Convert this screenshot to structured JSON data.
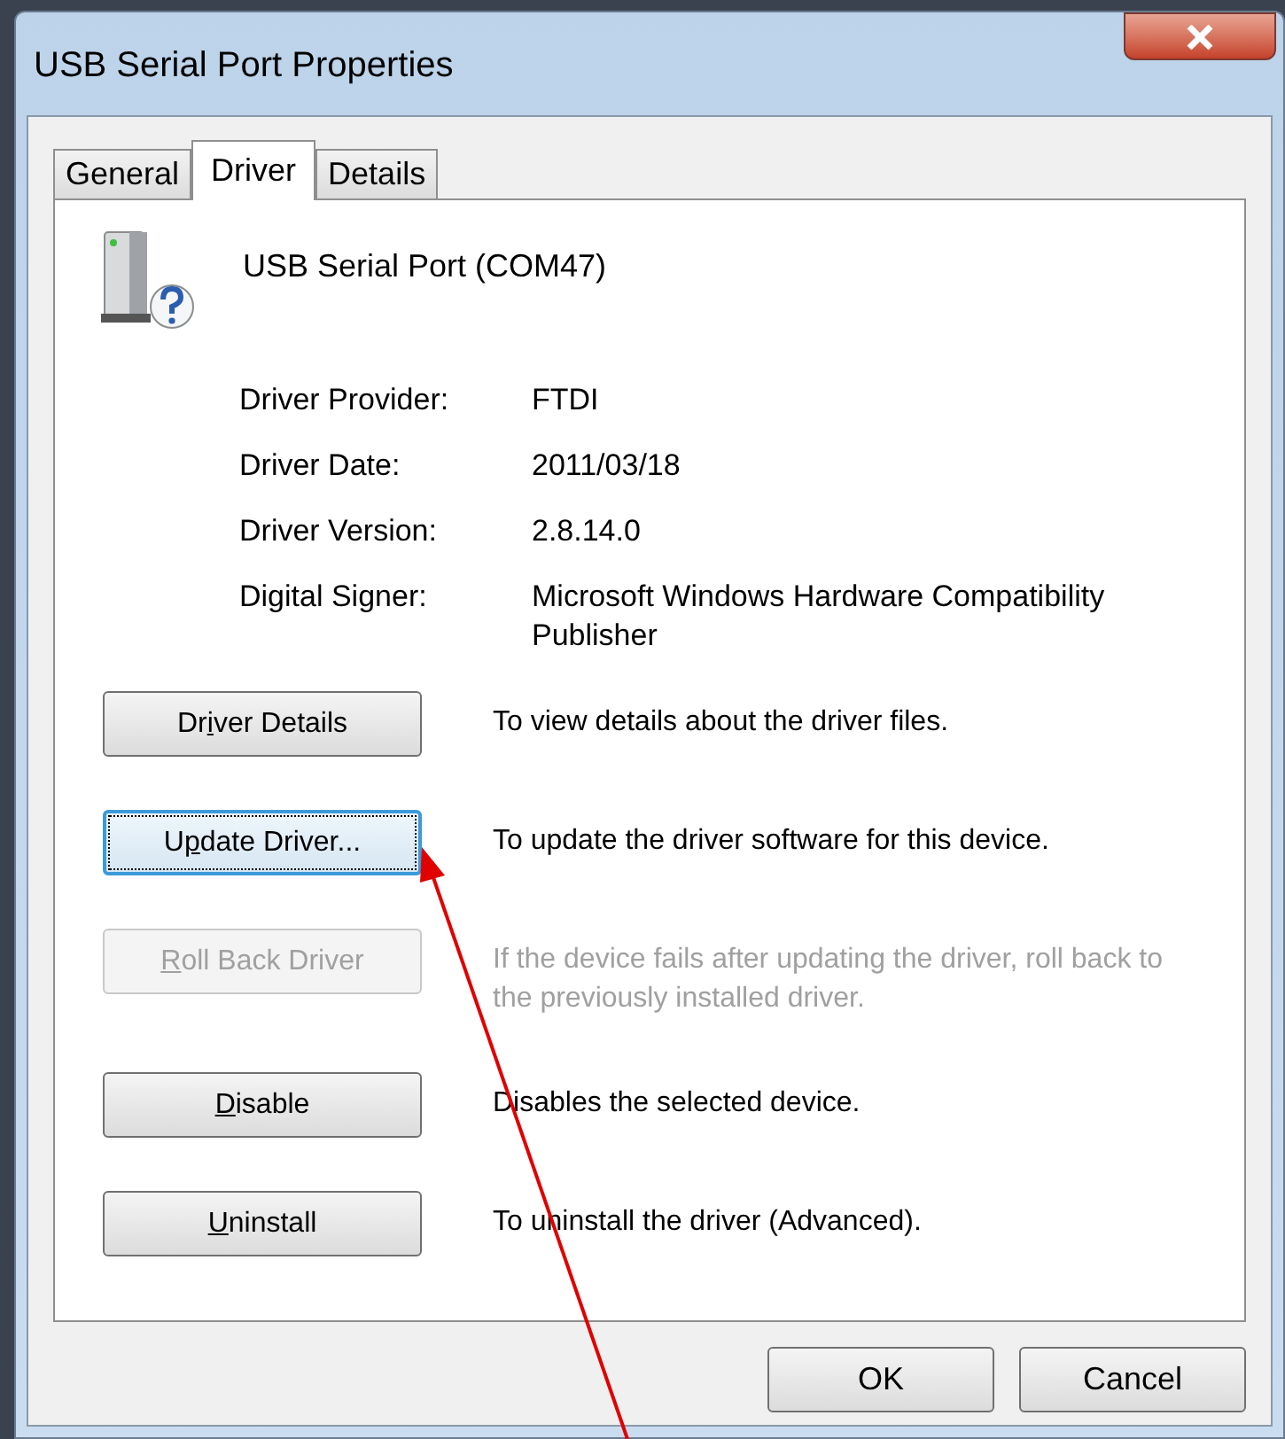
{
  "window": {
    "title": "USB Serial Port Properties"
  },
  "tabs": [
    {
      "label": "General",
      "selected": false
    },
    {
      "label": "Driver",
      "selected": true
    },
    {
      "label": "Details",
      "selected": false
    }
  ],
  "device": {
    "name": "USB Serial Port (COM47)"
  },
  "info": [
    {
      "label": "Driver Provider:",
      "value": "FTDI"
    },
    {
      "label": "Driver Date:",
      "value": "2011/03/18"
    },
    {
      "label": "Driver Version:",
      "value": "2.8.14.0"
    },
    {
      "label": "Digital Signer:",
      "value": "Microsoft Windows Hardware Compatibility Publisher"
    }
  ],
  "actions": [
    {
      "label": {
        "before": "Dr",
        "key": "i",
        "after": "ver Details"
      },
      "description": "To view details about the driver files.",
      "disabled": false,
      "focused": false
    },
    {
      "label": {
        "before": "U",
        "key": "p",
        "after": "date Driver..."
      },
      "description": "To update the driver software for this device.",
      "disabled": false,
      "focused": true
    },
    {
      "label": {
        "key": "R",
        "after": "oll Back Driver"
      },
      "description": "If the device fails after updating the driver, roll back to the previously installed driver.",
      "disabled": true,
      "focused": false
    },
    {
      "label": {
        "key": "D",
        "after": "isable"
      },
      "description": "Disables the selected device.",
      "disabled": false,
      "focused": false
    },
    {
      "label": {
        "key": "U",
        "after": "ninstall"
      },
      "description": "To uninstall the driver (Advanced).",
      "disabled": false,
      "focused": false
    }
  ],
  "buttons": [
    "OK",
    "Cancel"
  ]
}
